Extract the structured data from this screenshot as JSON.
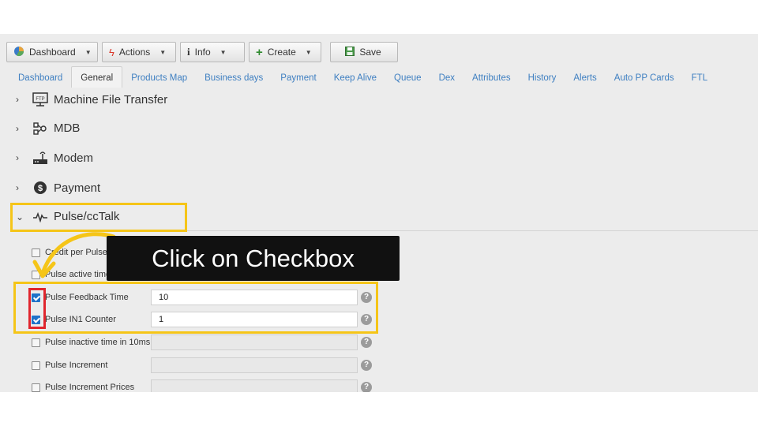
{
  "toolbar": {
    "dashboard_label": "Dashboard",
    "actions_label": "Actions",
    "info_label": "Info",
    "create_label": "Create",
    "save_label": "Save"
  },
  "tabs": [
    "Dashboard",
    "General",
    "Products Map",
    "Business days",
    "Payment",
    "Keep Alive",
    "Queue",
    "Dex",
    "Attributes",
    "History",
    "Alerts",
    "Auto PP Cards",
    "FTL"
  ],
  "active_tab": "General",
  "sections": [
    {
      "label": "Machine File Transfer",
      "icon": "ftp-icon"
    },
    {
      "label": "MDB",
      "icon": "mdb-icon"
    },
    {
      "label": "Modem",
      "icon": "modem-icon"
    },
    {
      "label": "Payment",
      "icon": "dollar-icon"
    },
    {
      "label": "Pulse/ccTalk",
      "icon": "pulse-icon"
    }
  ],
  "fields": [
    {
      "label": "Credit per Pulse",
      "checked": false,
      "value": ""
    },
    {
      "label": "Pulse active time",
      "checked": false,
      "value": ""
    },
    {
      "label": "Pulse Feedback Time",
      "checked": true,
      "value": "10"
    },
    {
      "label": "Pulse IN1 Counter",
      "checked": true,
      "value": "1"
    },
    {
      "label": "Pulse inactive time in 10ms",
      "checked": false,
      "value": ""
    },
    {
      "label": "Pulse Increment",
      "checked": false,
      "value": ""
    },
    {
      "label": "Pulse Increment Prices",
      "checked": false,
      "value": ""
    }
  ],
  "overlay": {
    "tooltip_text": "Click on Checkbox",
    "highlight_color": "#f5c518",
    "checkbox_highlight_color": "#e0262e"
  },
  "colors": {
    "tab_link": "#3e7fc1",
    "checkbox_checked": "#1e72c9"
  }
}
